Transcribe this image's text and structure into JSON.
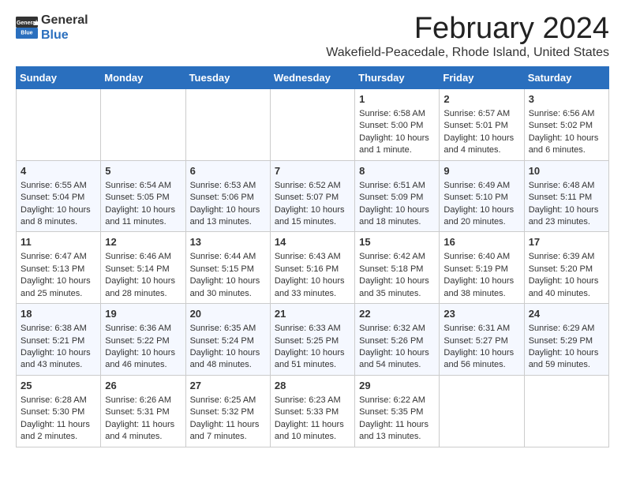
{
  "logo": {
    "general": "General",
    "blue": "Blue"
  },
  "title": "February 2024",
  "location": "Wakefield-Peacedale, Rhode Island, United States",
  "weekdays": [
    "Sunday",
    "Monday",
    "Tuesday",
    "Wednesday",
    "Thursday",
    "Friday",
    "Saturday"
  ],
  "weeks": [
    [
      {
        "day": "",
        "content": ""
      },
      {
        "day": "",
        "content": ""
      },
      {
        "day": "",
        "content": ""
      },
      {
        "day": "",
        "content": ""
      },
      {
        "day": "1",
        "content": "Sunrise: 6:58 AM\nSunset: 5:00 PM\nDaylight: 10 hours and 1 minute."
      },
      {
        "day": "2",
        "content": "Sunrise: 6:57 AM\nSunset: 5:01 PM\nDaylight: 10 hours and 4 minutes."
      },
      {
        "day": "3",
        "content": "Sunrise: 6:56 AM\nSunset: 5:02 PM\nDaylight: 10 hours and 6 minutes."
      }
    ],
    [
      {
        "day": "4",
        "content": "Sunrise: 6:55 AM\nSunset: 5:04 PM\nDaylight: 10 hours and 8 minutes."
      },
      {
        "day": "5",
        "content": "Sunrise: 6:54 AM\nSunset: 5:05 PM\nDaylight: 10 hours and 11 minutes."
      },
      {
        "day": "6",
        "content": "Sunrise: 6:53 AM\nSunset: 5:06 PM\nDaylight: 10 hours and 13 minutes."
      },
      {
        "day": "7",
        "content": "Sunrise: 6:52 AM\nSunset: 5:07 PM\nDaylight: 10 hours and 15 minutes."
      },
      {
        "day": "8",
        "content": "Sunrise: 6:51 AM\nSunset: 5:09 PM\nDaylight: 10 hours and 18 minutes."
      },
      {
        "day": "9",
        "content": "Sunrise: 6:49 AM\nSunset: 5:10 PM\nDaylight: 10 hours and 20 minutes."
      },
      {
        "day": "10",
        "content": "Sunrise: 6:48 AM\nSunset: 5:11 PM\nDaylight: 10 hours and 23 minutes."
      }
    ],
    [
      {
        "day": "11",
        "content": "Sunrise: 6:47 AM\nSunset: 5:13 PM\nDaylight: 10 hours and 25 minutes."
      },
      {
        "day": "12",
        "content": "Sunrise: 6:46 AM\nSunset: 5:14 PM\nDaylight: 10 hours and 28 minutes."
      },
      {
        "day": "13",
        "content": "Sunrise: 6:44 AM\nSunset: 5:15 PM\nDaylight: 10 hours and 30 minutes."
      },
      {
        "day": "14",
        "content": "Sunrise: 6:43 AM\nSunset: 5:16 PM\nDaylight: 10 hours and 33 minutes."
      },
      {
        "day": "15",
        "content": "Sunrise: 6:42 AM\nSunset: 5:18 PM\nDaylight: 10 hours and 35 minutes."
      },
      {
        "day": "16",
        "content": "Sunrise: 6:40 AM\nSunset: 5:19 PM\nDaylight: 10 hours and 38 minutes."
      },
      {
        "day": "17",
        "content": "Sunrise: 6:39 AM\nSunset: 5:20 PM\nDaylight: 10 hours and 40 minutes."
      }
    ],
    [
      {
        "day": "18",
        "content": "Sunrise: 6:38 AM\nSunset: 5:21 PM\nDaylight: 10 hours and 43 minutes."
      },
      {
        "day": "19",
        "content": "Sunrise: 6:36 AM\nSunset: 5:22 PM\nDaylight: 10 hours and 46 minutes."
      },
      {
        "day": "20",
        "content": "Sunrise: 6:35 AM\nSunset: 5:24 PM\nDaylight: 10 hours and 48 minutes."
      },
      {
        "day": "21",
        "content": "Sunrise: 6:33 AM\nSunset: 5:25 PM\nDaylight: 10 hours and 51 minutes."
      },
      {
        "day": "22",
        "content": "Sunrise: 6:32 AM\nSunset: 5:26 PM\nDaylight: 10 hours and 54 minutes."
      },
      {
        "day": "23",
        "content": "Sunrise: 6:31 AM\nSunset: 5:27 PM\nDaylight: 10 hours and 56 minutes."
      },
      {
        "day": "24",
        "content": "Sunrise: 6:29 AM\nSunset: 5:29 PM\nDaylight: 10 hours and 59 minutes."
      }
    ],
    [
      {
        "day": "25",
        "content": "Sunrise: 6:28 AM\nSunset: 5:30 PM\nDaylight: 11 hours and 2 minutes."
      },
      {
        "day": "26",
        "content": "Sunrise: 6:26 AM\nSunset: 5:31 PM\nDaylight: 11 hours and 4 minutes."
      },
      {
        "day": "27",
        "content": "Sunrise: 6:25 AM\nSunset: 5:32 PM\nDaylight: 11 hours and 7 minutes."
      },
      {
        "day": "28",
        "content": "Sunrise: 6:23 AM\nSunset: 5:33 PM\nDaylight: 11 hours and 10 minutes."
      },
      {
        "day": "29",
        "content": "Sunrise: 6:22 AM\nSunset: 5:35 PM\nDaylight: 11 hours and 13 minutes."
      },
      {
        "day": "",
        "content": ""
      },
      {
        "day": "",
        "content": ""
      }
    ]
  ]
}
